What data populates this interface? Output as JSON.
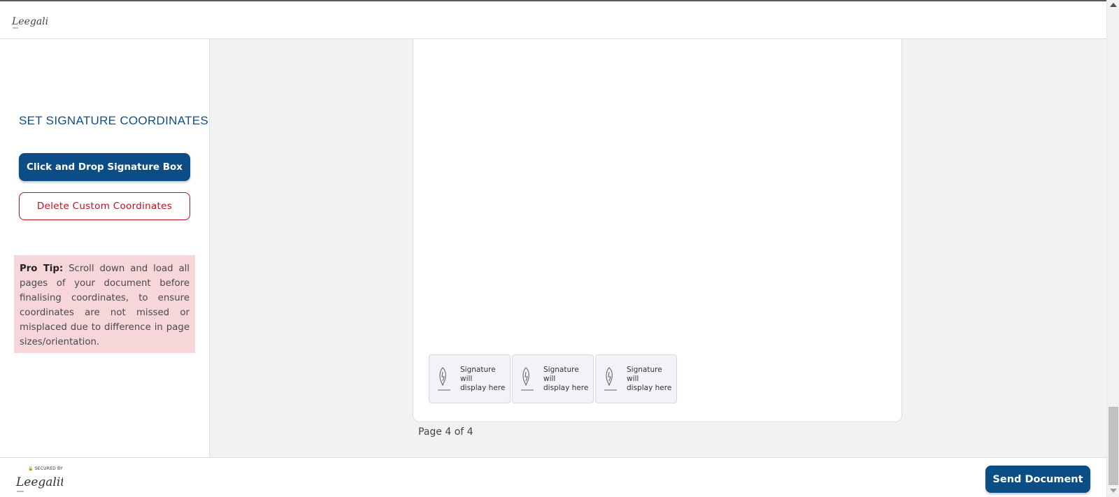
{
  "header": {
    "logo_text": "Leegality"
  },
  "sidebar": {
    "title": "SET SIGNATURE COORDINATES",
    "click_drop_label": "Click and Drop Signature Box",
    "delete_label": "Delete Custom Coordinates",
    "pro_tip_label": "Pro Tip:",
    "pro_tip_text": "Scroll down and load all pages of your document before finalising coordinates, to ensure coordinates are not missed or misplaced due to difference in page sizes/orientation."
  },
  "document": {
    "signature_boxes": [
      {
        "line1": "Signature will",
        "line2": "display here",
        "icon": "pen-nib-icon"
      },
      {
        "line1": "Signature will",
        "line2": "display here",
        "icon": "pen-nib-icon"
      },
      {
        "line1": "Signature will",
        "line2": "display here",
        "icon": "pen-nib-icon"
      }
    ],
    "page_indicator": "Page 4 of 4"
  },
  "footer": {
    "secured_by": "SECURED BY",
    "logo_text": "Leegality",
    "send_label": "Send Document"
  },
  "colors": {
    "primary": "#0d4d85",
    "danger": "#c0101c",
    "tip_background": "#f7d6da",
    "canvas_background": "#f2f2f2"
  }
}
